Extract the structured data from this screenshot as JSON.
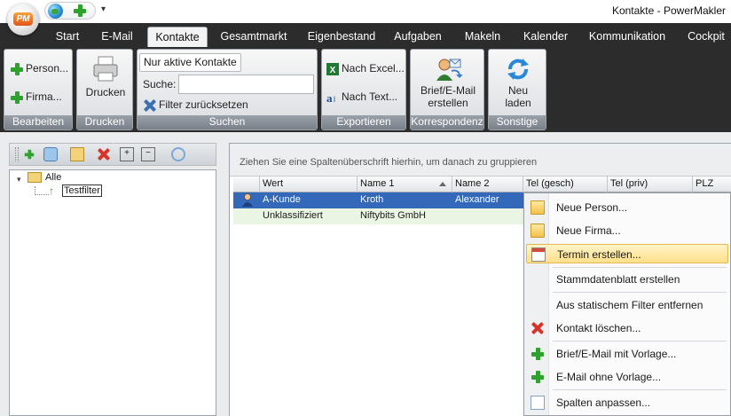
{
  "window": {
    "title": "Kontakte - PowerMakler",
    "app_logo": "PM"
  },
  "quick_access": {
    "dropdown_glyph": "▾"
  },
  "tabs": [
    "Start",
    "E-Mail",
    "Kontakte",
    "Gesamtmarkt",
    "Eigenbestand",
    "Aufgaben",
    "Makeln",
    "Kalender",
    "Kommunikation",
    "Cockpit"
  ],
  "active_tab": "Kontakte",
  "ribbon": {
    "bearbeiten": {
      "label": "Bearbeiten",
      "person": "Person...",
      "firma": "Firma..."
    },
    "drucken": {
      "label": "Drucken",
      "button": "Drucken"
    },
    "suchen": {
      "label": "Suchen",
      "filter_badge": "Nur aktive Kontakte",
      "search_label": "Suche:",
      "search_value": "",
      "reset": "Filter zurücksetzen"
    },
    "exportieren": {
      "label": "Exportieren",
      "excel": "Nach Excel...",
      "text": "Nach Text..."
    },
    "korrespondenz": {
      "label": "Korrespondenz",
      "line1": "Brief/E-Mail",
      "line2": "erstellen"
    },
    "sonstige": {
      "label": "Sonstige",
      "line1": "Neu",
      "line2": "laden"
    }
  },
  "tree": {
    "root": "Alle",
    "child": "Testfilter",
    "expander": "▾"
  },
  "grid": {
    "group_hint": "Ziehen Sie eine Spaltenüberschrift hierhin, um danach zu gruppieren",
    "columns": [
      "Wert",
      "Name 1",
      "Name 2",
      "Tel (gesch)",
      "Tel (priv)",
      "PLZ"
    ],
    "rows": [
      {
        "wert": "A-Kunde",
        "name1": "Kroth",
        "name2": "Alexander"
      },
      {
        "wert": "Unklassifiziert",
        "name1": "Niftybits GmbH",
        "name2": ""
      }
    ]
  },
  "context_menu": {
    "items": [
      {
        "label": "Neue Person...",
        "icon": "envelope-icon"
      },
      {
        "label": "Neue Firma...",
        "icon": "envelope-icon"
      },
      {
        "label": "Termin erstellen...",
        "icon": "calendar-icon"
      },
      {
        "label": "Stammdatenblatt erstellen",
        "icon": ""
      },
      {
        "label": "Aus statischem Filter entfernen",
        "icon": ""
      },
      {
        "label": "Kontakt löschen...",
        "icon": "red-x-icon"
      },
      {
        "label": "Brief/E-Mail mit Vorlage...",
        "icon": "green-plus-icon"
      },
      {
        "label": "E-Mail ohne Vorlage...",
        "icon": "green-plus-icon"
      },
      {
        "label": "Spalten anpassen...",
        "icon": "columns-icon"
      }
    ],
    "highlighted": "Termin erstellen..."
  },
  "colors": {
    "selection": "#3468b8",
    "ribbon_bg": "#2c2c2c",
    "alt_row": "#eaf5e3",
    "highlight": "#ffe08a"
  }
}
